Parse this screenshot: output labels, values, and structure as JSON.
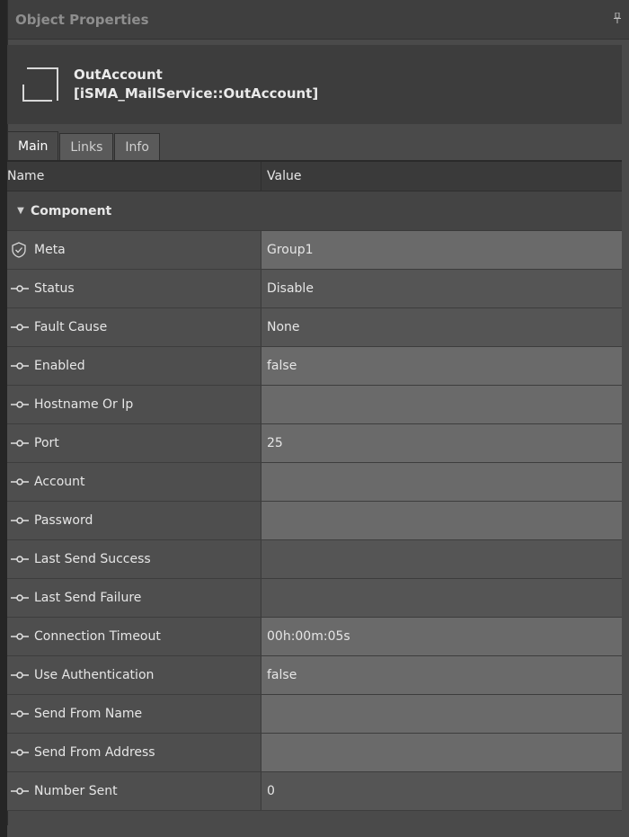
{
  "panel": {
    "title": "Object Properties",
    "pin_icon": "pin-icon"
  },
  "object": {
    "name": "OutAccount",
    "type": "[iSMA_MailService::OutAccount]",
    "icon": "component-frame-icon"
  },
  "tabs": [
    {
      "label": "Main",
      "active": true
    },
    {
      "label": "Links",
      "active": false
    },
    {
      "label": "Info",
      "active": false
    }
  ],
  "grid": {
    "header": {
      "name": "Name",
      "value": "Value"
    },
    "group": {
      "label": "Component",
      "expanded": true
    },
    "rows": [
      {
        "name": "Meta",
        "value": "Group1",
        "icon": "shield-check-icon",
        "editable": true
      },
      {
        "name": "Status",
        "value": "Disable",
        "icon": "slot-link-icon",
        "editable": false
      },
      {
        "name": "Fault Cause",
        "value": "None",
        "icon": "slot-link-icon",
        "editable": false
      },
      {
        "name": "Enabled",
        "value": "false",
        "icon": "slot-link-icon",
        "editable": true
      },
      {
        "name": "Hostname Or Ip",
        "value": "",
        "icon": "slot-link-icon",
        "editable": true
      },
      {
        "name": "Port",
        "value": "25",
        "icon": "slot-link-icon",
        "editable": true
      },
      {
        "name": "Account",
        "value": "",
        "icon": "slot-link-icon",
        "editable": true
      },
      {
        "name": "Password",
        "value": "",
        "icon": "slot-link-icon",
        "editable": true
      },
      {
        "name": "Last Send Success",
        "value": "",
        "icon": "slot-link-icon",
        "editable": false
      },
      {
        "name": "Last Send Failure",
        "value": "",
        "icon": "slot-link-icon",
        "editable": false
      },
      {
        "name": "Connection Timeout",
        "value": "00h:00m:05s",
        "icon": "slot-link-icon",
        "editable": true
      },
      {
        "name": "Use Authentication",
        "value": "false",
        "icon": "slot-link-icon",
        "editable": true
      },
      {
        "name": "Send From Name",
        "value": "",
        "icon": "slot-link-icon",
        "editable": true
      },
      {
        "name": "Send From Address",
        "value": "",
        "icon": "slot-link-icon",
        "editable": true
      },
      {
        "name": "Number Sent",
        "value": "0",
        "icon": "slot-link-icon",
        "editable": false
      }
    ]
  },
  "colors": {
    "panel_bg": "#4a4a4a",
    "editable_value_bg": "#6a6a6a",
    "readonly_value_bg": "#555555",
    "title_text": "#8e8e8e"
  }
}
